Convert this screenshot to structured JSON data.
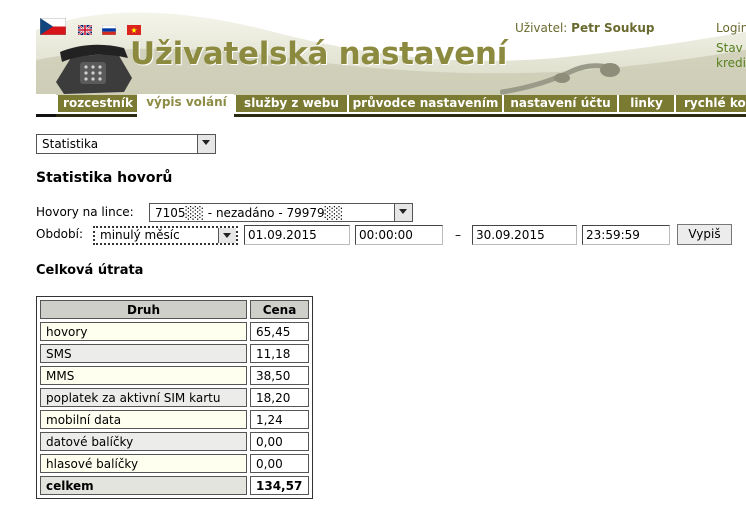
{
  "header": {
    "title": "Uživatelská nastavení",
    "user_label": "Uživatel:",
    "user_name": "Petr Soukup",
    "login": "Login",
    "stav_line1": "Stav",
    "stav_line2": "kredi",
    "flags": [
      "czech-flag",
      "uk-flag",
      "russian-flag",
      "vietnam-flag"
    ]
  },
  "tabs": [
    "rozcestník",
    "výpis volání",
    "služby z webu",
    "průvodce nastavením",
    "nastavení účtu",
    "linky",
    "rychlé kon"
  ],
  "active_tab": "výpis volání",
  "report_select": "Statistika",
  "page_title": "Statistika hovorů",
  "filters": {
    "line_label": "Hovory na lince:",
    "line_value": "7105░░ - nezadáno - 79979░░",
    "period_label": "Období:",
    "period_value": "minulý měsíc",
    "date_from": "01.09.2015",
    "time_from": "00:00:00",
    "dash": "–",
    "date_to": "30.09.2015",
    "time_to": "23:59:59",
    "submit": "Vypiš"
  },
  "section_title": "Celková útrata",
  "table": {
    "headers": [
      "Druh",
      "Cena"
    ],
    "rows": [
      {
        "name": "hovory",
        "value": "65,45"
      },
      {
        "name": "SMS",
        "value": "11,18"
      },
      {
        "name": "MMS",
        "value": "38,50"
      },
      {
        "name": "poplatek za aktivní SIM kartu",
        "value": "18,20"
      },
      {
        "name": "mobilní data",
        "value": "1,24"
      },
      {
        "name": "datové balíčky",
        "value": "0,00"
      },
      {
        "name": "hlasové balíčky",
        "value": "0,00"
      }
    ],
    "total": {
      "name": "celkem",
      "value": "134,57"
    }
  },
  "colors": {
    "accent": "#7a7a33",
    "title": "#8b8a3e",
    "link": "#58801f"
  }
}
